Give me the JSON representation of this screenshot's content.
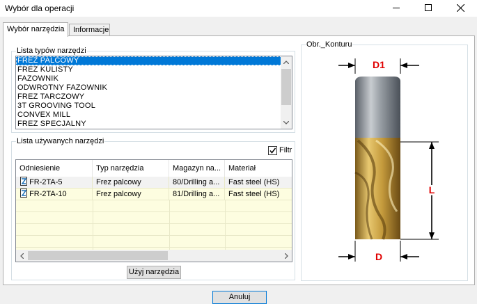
{
  "window": {
    "title": "Wybór dla operacji"
  },
  "tabs": [
    {
      "label": "Wybór narzędzia",
      "active": true
    },
    {
      "label": "Informacje",
      "active": false
    }
  ],
  "tool_types": {
    "legend": "Lista typów narzędzi",
    "items": [
      "FREZ PALCOWY",
      "FREZ KULISTY",
      "FAZOWNIK",
      "ODWROTNY FAZOWNIK",
      "FREZ TARCZOWY",
      "3T GROOVING TOOL",
      "CONVEX MILL",
      "FREZ SPECJALNY"
    ],
    "selected": "FREZ PALCOWY"
  },
  "used_tools": {
    "legend": "Lista używanych narzędzi",
    "filter_label": "Filtr",
    "filter_checked": true,
    "columns": [
      "Odniesienie",
      "Typ narzędzia",
      "Magazyn na...",
      "Materiał"
    ],
    "rows": [
      {
        "ref": "FR-2TA-5",
        "type": "Frez palcowy",
        "magazine": "80/Drilling a...",
        "material": "Fast steel (HS)"
      },
      {
        "ref": "FR-2TA-10",
        "type": "Frez palcowy",
        "magazine": "81/Drilling a...",
        "material": "Fast steel (HS)"
      }
    ],
    "use_button": "Użyj narzędzia"
  },
  "contour": {
    "legend": "Obr._Konturu",
    "dims": {
      "top": "D1",
      "bottom": "D",
      "length": "L"
    }
  },
  "footer": {
    "cancel": "Anuluj"
  },
  "colors": {
    "accent": "#0078d7",
    "dimension": "#e00000",
    "grid_bg": "#fdfde0"
  }
}
